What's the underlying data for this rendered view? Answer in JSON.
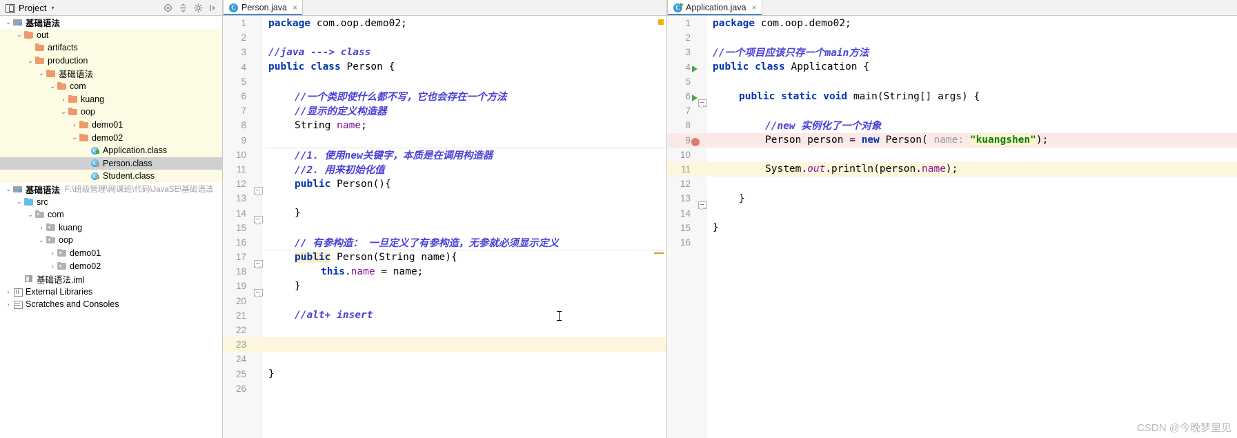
{
  "toolwindow": {
    "title": "Project",
    "caret": "▾",
    "icon": "project-icon",
    "actions": [
      "target-icon",
      "collapse-all-icon",
      "settings-icon",
      "hide-icon"
    ]
  },
  "tree": {
    "items": [
      {
        "depth": 0,
        "arrow": "⌄",
        "icon": "module",
        "label": "基础语法",
        "bold": true,
        "path": "",
        "style": "plain"
      },
      {
        "depth": 1,
        "arrow": "⌄",
        "icon": "folder-o",
        "label": "out",
        "bold": false,
        "path": "",
        "style": "shade"
      },
      {
        "depth": 2,
        "arrow": "",
        "icon": "folder-o",
        "label": "artifacts",
        "bold": false,
        "path": "",
        "style": "shade"
      },
      {
        "depth": 2,
        "arrow": "⌄",
        "icon": "folder-o",
        "label": "production",
        "bold": false,
        "path": "",
        "style": "shade"
      },
      {
        "depth": 3,
        "arrow": "⌄",
        "icon": "folder-o",
        "label": "基础语法",
        "bold": false,
        "path": "",
        "style": "shade"
      },
      {
        "depth": 4,
        "arrow": "⌄",
        "icon": "folder-o",
        "label": "com",
        "bold": false,
        "path": "",
        "style": "shade"
      },
      {
        "depth": 5,
        "arrow": "›",
        "icon": "folder-o",
        "label": "kuang",
        "bold": false,
        "path": "",
        "style": "shade"
      },
      {
        "depth": 5,
        "arrow": "⌄",
        "icon": "folder-o",
        "label": "oop",
        "bold": false,
        "path": "",
        "style": "shade"
      },
      {
        "depth": 6,
        "arrow": "›",
        "icon": "folder-o",
        "label": "demo01",
        "bold": false,
        "path": "",
        "style": "shade"
      },
      {
        "depth": 6,
        "arrow": "⌄",
        "icon": "folder-o",
        "label": "demo02",
        "bold": false,
        "path": "",
        "style": "shade"
      },
      {
        "depth": 7,
        "arrow": "",
        "icon": "class-run",
        "label": "Application.class",
        "bold": false,
        "path": "",
        "style": "shade"
      },
      {
        "depth": 7,
        "arrow": "",
        "icon": "class",
        "label": "Person.class",
        "bold": false,
        "path": "",
        "style": "sel"
      },
      {
        "depth": 7,
        "arrow": "",
        "icon": "class",
        "label": "Student.class",
        "bold": false,
        "path": "",
        "style": "shade"
      },
      {
        "depth": 0,
        "arrow": "⌄",
        "icon": "module",
        "label": "基础语法",
        "bold": true,
        "path": "F:\\班级管理\\网课班\\代码\\JavaSE\\基础语法",
        "style": "plain"
      },
      {
        "depth": 1,
        "arrow": "⌄",
        "icon": "folder-b",
        "label": "src",
        "bold": false,
        "path": "",
        "style": "plain"
      },
      {
        "depth": 2,
        "arrow": "⌄",
        "icon": "folder-g",
        "label": "com",
        "bold": false,
        "path": "",
        "style": "plain"
      },
      {
        "depth": 3,
        "arrow": "›",
        "icon": "folder-g",
        "label": "kuang",
        "bold": false,
        "path": "",
        "style": "plain"
      },
      {
        "depth": 3,
        "arrow": "⌄",
        "icon": "folder-g",
        "label": "oop",
        "bold": false,
        "path": "",
        "style": "plain"
      },
      {
        "depth": 4,
        "arrow": "›",
        "icon": "folder-g",
        "label": "demo01",
        "bold": false,
        "path": "",
        "style": "plain"
      },
      {
        "depth": 4,
        "arrow": "›",
        "icon": "folder-g",
        "label": "demo02",
        "bold": false,
        "path": "",
        "style": "plain"
      },
      {
        "depth": 1,
        "arrow": "",
        "icon": "iml",
        "label": "基础语法.iml",
        "bold": false,
        "path": "",
        "style": "plain"
      },
      {
        "depth": 0,
        "arrow": "›",
        "icon": "lib",
        "label": "External Libraries",
        "bold": false,
        "path": "",
        "style": "plain"
      },
      {
        "depth": 0,
        "arrow": "›",
        "icon": "scratch",
        "label": "Scratches and Consoles",
        "bold": false,
        "path": "",
        "style": "plain"
      }
    ]
  },
  "editors": {
    "left": {
      "tab": {
        "label": "Person.java",
        "icon": "java-class-icon",
        "close": "×",
        "runnable": false
      },
      "lines": [
        {
          "n": "1",
          "spans": [
            {
              "t": "package ",
              "c": "kw"
            },
            {
              "t": "com.oop.demo02;",
              "c": "pl"
            }
          ],
          "indent": 0
        },
        {
          "n": "2",
          "spans": [],
          "indent": 0
        },
        {
          "n": "3",
          "spans": [
            {
              "t": "//java ---> class",
              "c": "cm"
            }
          ],
          "indent": 0
        },
        {
          "n": "4",
          "spans": [
            {
              "t": "public class ",
              "c": "kw"
            },
            {
              "t": "Person {",
              "c": "pl"
            }
          ],
          "indent": 0
        },
        {
          "n": "5",
          "spans": [],
          "indent": 0
        },
        {
          "n": "6",
          "spans": [
            {
              "t": "//一个类即使什么都不写，它也会存在一个方法",
              "c": "cm"
            }
          ],
          "indent": 1
        },
        {
          "n": "7",
          "spans": [
            {
              "t": "//显示的定义构造器",
              "c": "cm"
            }
          ],
          "indent": 1
        },
        {
          "n": "8",
          "spans": [
            {
              "t": "String",
              "c": "pl"
            },
            {
              "t": " ",
              "c": "pl"
            },
            {
              "t": "name",
              "c": "fld"
            },
            {
              "t": ";",
              "c": "pl"
            }
          ],
          "indent": 1
        },
        {
          "n": "9",
          "spans": [],
          "indent": 0
        },
        {
          "n": "10",
          "spans": [
            {
              "t": "//1. 使用new关键字，本质是在调用构造器",
              "c": "cm"
            }
          ],
          "indent": 1
        },
        {
          "n": "11",
          "spans": [
            {
              "t": "//2. 用来初始化值",
              "c": "cm"
            }
          ],
          "indent": 1
        },
        {
          "n": "12",
          "spans": [
            {
              "t": "public ",
              "c": "kw"
            },
            {
              "t": "Person",
              "c": "sfn"
            },
            {
              "t": "(){",
              "c": "pl"
            }
          ],
          "indent": 1
        },
        {
          "n": "13",
          "spans": [],
          "indent": 0
        },
        {
          "n": "14",
          "spans": [
            {
              "t": "}",
              "c": "pl"
            }
          ],
          "indent": 1
        },
        {
          "n": "15",
          "spans": [],
          "indent": 0
        },
        {
          "n": "16",
          "spans": [
            {
              "t": "// 有参构造： 一旦定义了有参构造，无参就必须显示定义",
              "c": "cm"
            }
          ],
          "indent": 1
        },
        {
          "n": "17",
          "spans": [
            {
              "t": "public",
              "c": "kwhl"
            },
            {
              "t": " ",
              "c": "pl"
            },
            {
              "t": "Person",
              "c": "sfn"
            },
            {
              "t": "(",
              "c": "pl"
            },
            {
              "t": "String",
              "c": "pl"
            },
            {
              "t": " name){",
              "c": "pl"
            }
          ],
          "indent": 1
        },
        {
          "n": "18",
          "spans": [
            {
              "t": "this",
              "c": "kw"
            },
            {
              "t": ".",
              "c": "pl"
            },
            {
              "t": "name",
              "c": "fld"
            },
            {
              "t": " = name;",
              "c": "pl"
            }
          ],
          "indent": 2
        },
        {
          "n": "19",
          "spans": [
            {
              "t": "}",
              "c": "pl"
            }
          ],
          "indent": 1
        },
        {
          "n": "20",
          "spans": [],
          "indent": 0
        },
        {
          "n": "21",
          "spans": [
            {
              "t": "//alt+ insert",
              "c": "cm"
            }
          ],
          "indent": 1
        },
        {
          "n": "22",
          "spans": [],
          "indent": 0
        },
        {
          "n": "23",
          "spans": [],
          "indent": 0
        },
        {
          "n": "24",
          "spans": [],
          "indent": 0
        },
        {
          "n": "25",
          "spans": [
            {
              "t": "}",
              "c": "pl"
            }
          ],
          "indent": 0
        },
        {
          "n": "26",
          "spans": [],
          "indent": 0
        }
      ]
    },
    "right": {
      "tab": {
        "label": "Application.java",
        "icon": "java-runnable-class-icon",
        "close": "×",
        "runnable": true
      },
      "lines": [
        {
          "n": "1",
          "spans": [
            {
              "t": "package ",
              "c": "kw"
            },
            {
              "t": "com.oop.demo02;",
              "c": "pl"
            }
          ],
          "indent": 0
        },
        {
          "n": "2",
          "spans": [],
          "indent": 0
        },
        {
          "n": "3",
          "spans": [
            {
              "t": "//一个项目应该只存一个main方法",
              "c": "cm"
            }
          ],
          "indent": 0
        },
        {
          "n": "4",
          "spans": [
            {
              "t": "public class ",
              "c": "kw"
            },
            {
              "t": "Application {",
              "c": "pl"
            }
          ],
          "indent": 0
        },
        {
          "n": "5",
          "spans": [],
          "indent": 0
        },
        {
          "n": "6",
          "spans": [
            {
              "t": "public static void ",
              "c": "kw"
            },
            {
              "t": "main(",
              "c": "pl"
            },
            {
              "t": "String",
              "c": "pl"
            },
            {
              "t": "[] args) {",
              "c": "pl"
            }
          ],
          "indent": 1
        },
        {
          "n": "7",
          "spans": [],
          "indent": 0
        },
        {
          "n": "8",
          "spans": [
            {
              "t": "//new 实例化了一个对象",
              "c": "cm"
            }
          ],
          "indent": 2
        },
        {
          "n": "9",
          "spans": [
            {
              "t": "Person person = ",
              "c": "pl"
            },
            {
              "t": "new ",
              "c": "kw"
            },
            {
              "t": "Person( ",
              "c": "pl"
            },
            {
              "t": "name:",
              "c": "hint"
            },
            {
              "t": " ",
              "c": "pl"
            },
            {
              "t": "\"kuangshen\"",
              "c": "str"
            },
            {
              "t": ");",
              "c": "pl"
            }
          ],
          "indent": 2
        },
        {
          "n": "10",
          "spans": [],
          "indent": 0
        },
        {
          "n": "11",
          "spans": [
            {
              "t": "System.",
              "c": "pl"
            },
            {
              "t": "out",
              "c": "ital"
            },
            {
              "t": ".println(person.",
              "c": "pl"
            },
            {
              "t": "name",
              "c": "fld"
            },
            {
              "t": ");",
              "c": "pl"
            }
          ],
          "indent": 2
        },
        {
          "n": "12",
          "spans": [],
          "indent": 0
        },
        {
          "n": "13",
          "spans": [
            {
              "t": "}",
              "c": "pl"
            }
          ],
          "indent": 1
        },
        {
          "n": "14",
          "spans": [],
          "indent": 0
        },
        {
          "n": "15",
          "spans": [
            {
              "t": "}",
              "c": "pl"
            }
          ],
          "indent": 0
        },
        {
          "n": "16",
          "spans": [],
          "indent": 0
        }
      ]
    }
  },
  "watermark": {
    "text": "CSDN @今晚梦里见"
  },
  "colors": {
    "keyword": "#0033b3",
    "comment": "#4a41d6",
    "field": "#871094",
    "string": "#067d17",
    "hint": "#9a9a9a",
    "folder_orange": "#ef9a6b",
    "folder_grey": "#b0b4b8",
    "folder_blue": "#62c0e8",
    "selection": "#d0d0d0",
    "shade": "#fdfbe3",
    "breakpoint": "#e07a6a",
    "run_green": "#4aa84a",
    "tab_underline": "#4a86c8",
    "marker_yellow": "#f0b400"
  }
}
